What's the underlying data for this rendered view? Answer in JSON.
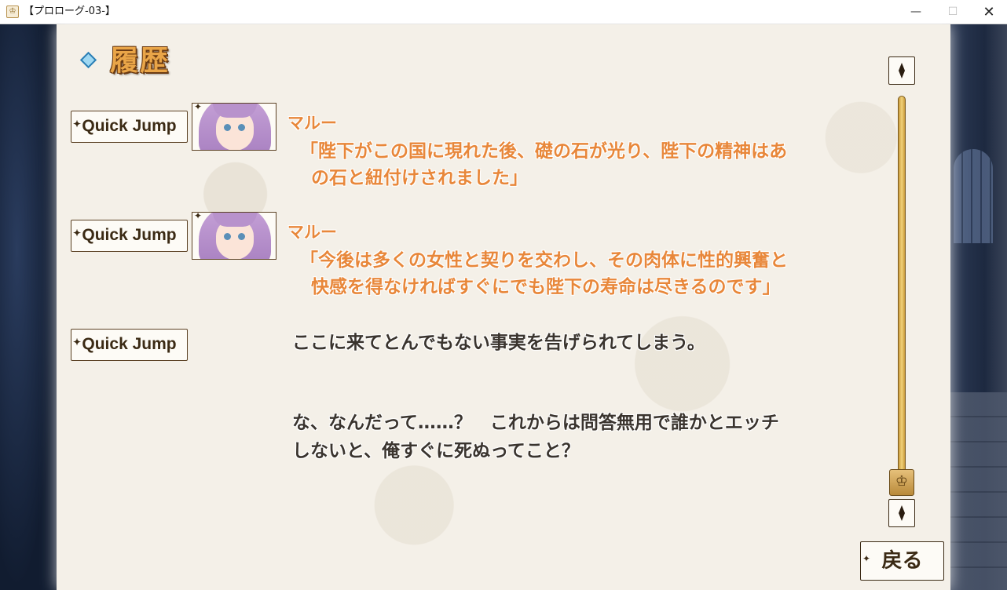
{
  "window": {
    "title": "【プロローグ-03-】",
    "minimize": "—",
    "maximize": "☐",
    "close": "✕"
  },
  "header": {
    "title": "履歴"
  },
  "entries": [
    {
      "jump_label": "Quick Jump",
      "speaker": "マルー",
      "lines": [
        "「陛下がこの国に現れた後、礎の石が光り、陛下の精神はあ",
        "の石と紐付けされました」"
      ]
    },
    {
      "jump_label": "Quick Jump",
      "speaker": "マルー",
      "lines": [
        "「今後は多くの女性と契りを交わし、その肉体に性的興奮と",
        "快感を得なければすぐにでも陛下の寿命は尽きるのです」"
      ]
    },
    {
      "jump_label": "Quick Jump",
      "speaker": "",
      "lines": [
        "ここに来てとんでもない事実を告げられてしまう。"
      ]
    },
    {
      "jump_label": "",
      "speaker": "",
      "lines": [
        "な、なんだって……？　これからは問答無用で誰かとエッチ",
        "しないと、俺すぐに死ぬってこと？"
      ]
    }
  ],
  "scrollbar": {
    "thumb_icon": "♔",
    "position": 1.0
  },
  "back_button": {
    "label": "戻る"
  },
  "colors": {
    "speaker": "#e8873a",
    "narration": "#3a342e",
    "accent": "#2b7fb5"
  },
  "icons": [
    "app-icon",
    "diamond-icon",
    "crown-icon",
    "up-arrow-icon",
    "down-arrow-icon"
  ]
}
